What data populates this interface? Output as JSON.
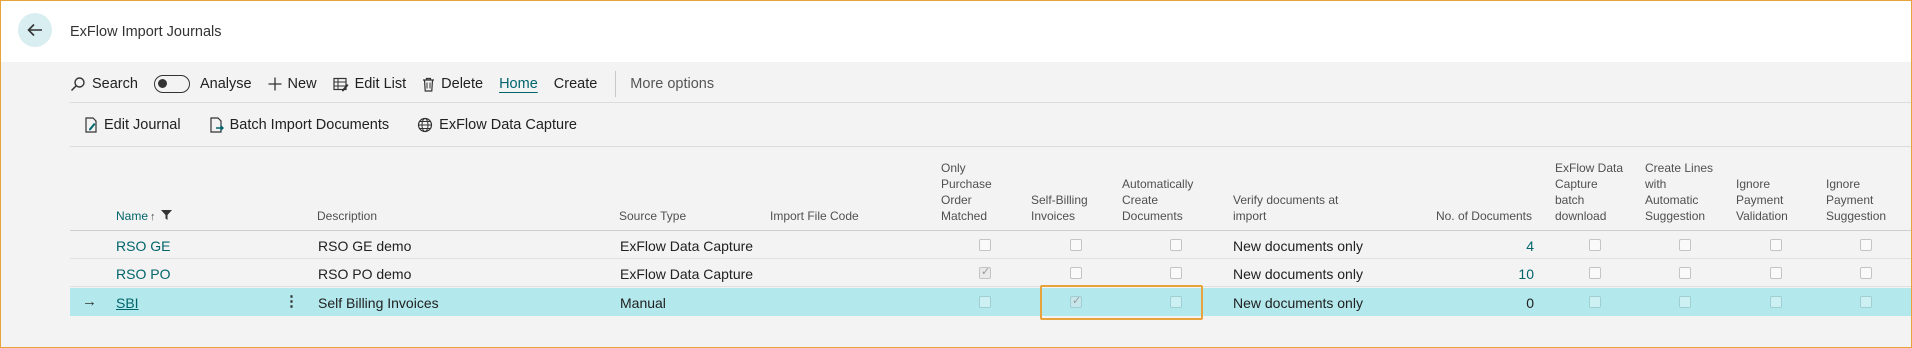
{
  "page": {
    "title": "ExFlow Import Journals"
  },
  "actions": {
    "search": "Search",
    "analyse": "Analyse",
    "new": "New",
    "edit_list": "Edit List",
    "delete": "Delete",
    "home": "Home",
    "create": "Create",
    "more": "More options"
  },
  "promoted": {
    "edit_journal": "Edit Journal",
    "batch_import": "Batch Import Documents",
    "data_capture": "ExFlow Data Capture"
  },
  "columns": {
    "name": "Name",
    "description": "Description",
    "source_type": "Source Type",
    "import_file_code": "Import File Code",
    "only_po": [
      "Only",
      "Purchase",
      "Order",
      "Matched"
    ],
    "self_billing": [
      "Self-Billing",
      "Invoices"
    ],
    "auto_create": [
      "Automatically",
      "Create",
      "Documents"
    ],
    "verify": [
      "Verify documents at",
      "import"
    ],
    "no_docs": "No. of Documents",
    "batch_download": [
      "ExFlow Data",
      "Capture",
      "batch",
      "download"
    ],
    "create_lines": [
      "Create Lines",
      "with",
      "Automatic",
      "Suggestion"
    ],
    "ignore_validation": [
      "Ignore",
      "Payment",
      "Validation"
    ],
    "ignore_suggestion": [
      "Ignore",
      "Payment",
      "Suggestion"
    ]
  },
  "rows": [
    {
      "name": "RSO GE",
      "description": "RSO GE demo",
      "source_type": "ExFlow Data Capture",
      "import_file_code": "",
      "only_po": false,
      "self_billing": false,
      "auto_create": false,
      "verify": "New documents only",
      "no_docs": "4",
      "batch_download": false,
      "create_lines": false,
      "ignore_validation": false,
      "ignore_suggestion": false
    },
    {
      "name": "RSO PO",
      "description": "RSO PO demo",
      "source_type": "ExFlow Data Capture",
      "import_file_code": "",
      "only_po": true,
      "self_billing": false,
      "auto_create": false,
      "verify": "New documents only",
      "no_docs": "10",
      "batch_download": false,
      "create_lines": false,
      "ignore_validation": false,
      "ignore_suggestion": false
    },
    {
      "name": "SBI",
      "description": "Self Billing Invoices",
      "source_type": "Manual",
      "import_file_code": "",
      "only_po": false,
      "self_billing": true,
      "auto_create": false,
      "verify": "New documents only",
      "no_docs": "0",
      "batch_download": false,
      "create_lines": false,
      "ignore_validation": false,
      "ignore_suggestion": false
    }
  ],
  "colors": {
    "accent": "#00656b",
    "selected_row": "#b3e8ec",
    "highlight": "#e8a33d"
  }
}
